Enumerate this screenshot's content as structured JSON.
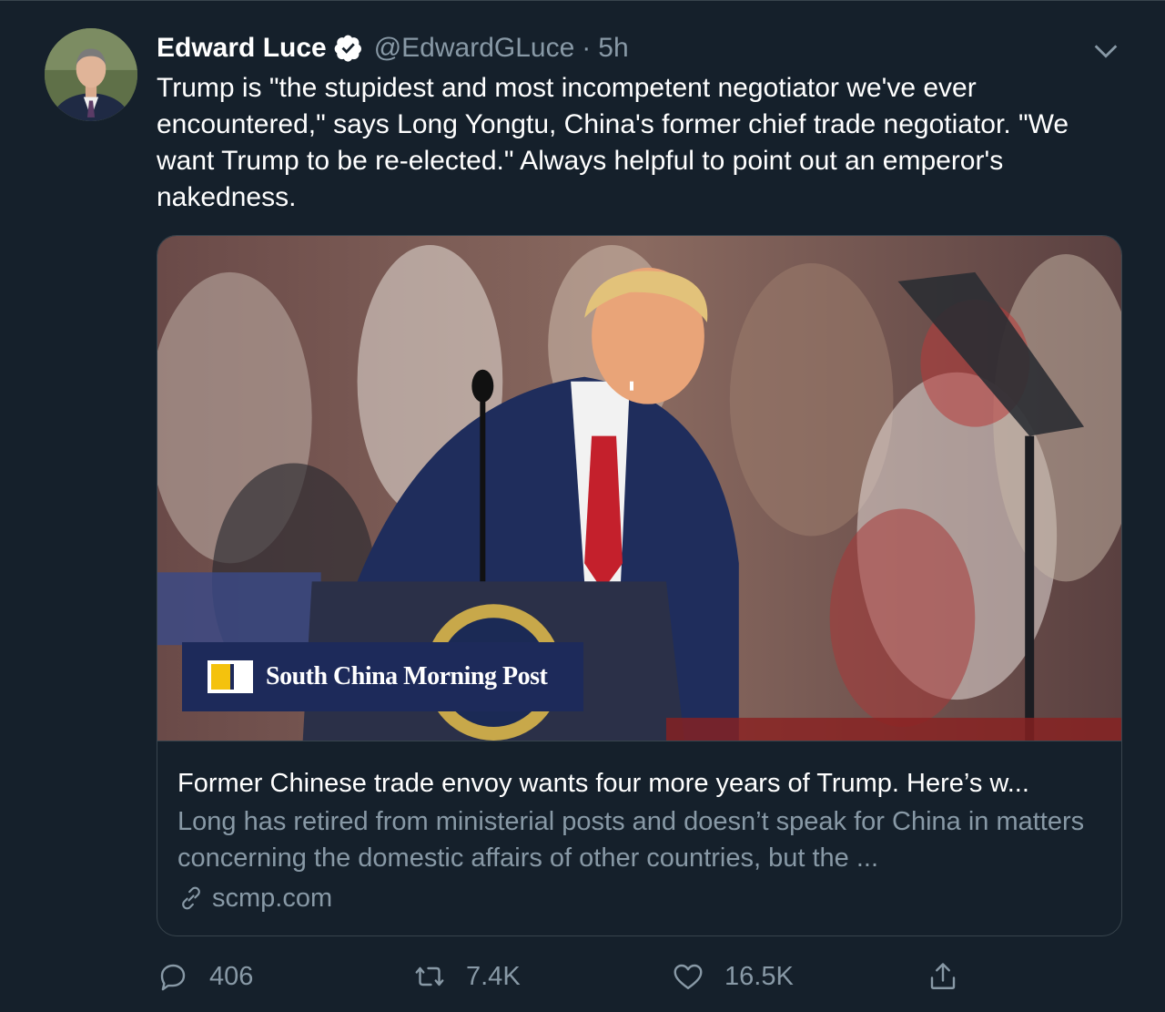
{
  "tweet": {
    "author_name": "Edward Luce",
    "handle": "@EdwardGLuce",
    "separator": "·",
    "time": "5h",
    "text": "Trump is \"the stupidest and most incompetent negotiator we've ever encountered,\" says Long Yongtu, China's former chief trade negotiator. \"We want Trump to be re-elected.\" Always helpful to point out an emperor's nakedness."
  },
  "card": {
    "source_banner": "South China Morning Post",
    "title": "Former Chinese trade envoy wants four more years of Trump. Here’s w...",
    "description": "Long has retired from ministerial posts and doesn’t speak for China in matters concerning the domestic affairs of other countries, but the ...",
    "domain": "scmp.com"
  },
  "actions": {
    "replies": "406",
    "retweets": "7.4K",
    "likes": "16.5K"
  },
  "icons": {
    "verified": "verified-badge-icon",
    "more": "chevron-down-icon",
    "reply": "reply-icon",
    "retweet": "retweet-icon",
    "like": "heart-icon",
    "share": "share-icon",
    "link": "link-icon"
  },
  "colors": {
    "background": "#15202b",
    "secondary_text": "#8899a6",
    "border": "#38444d",
    "banner": "#1d2a5a"
  }
}
